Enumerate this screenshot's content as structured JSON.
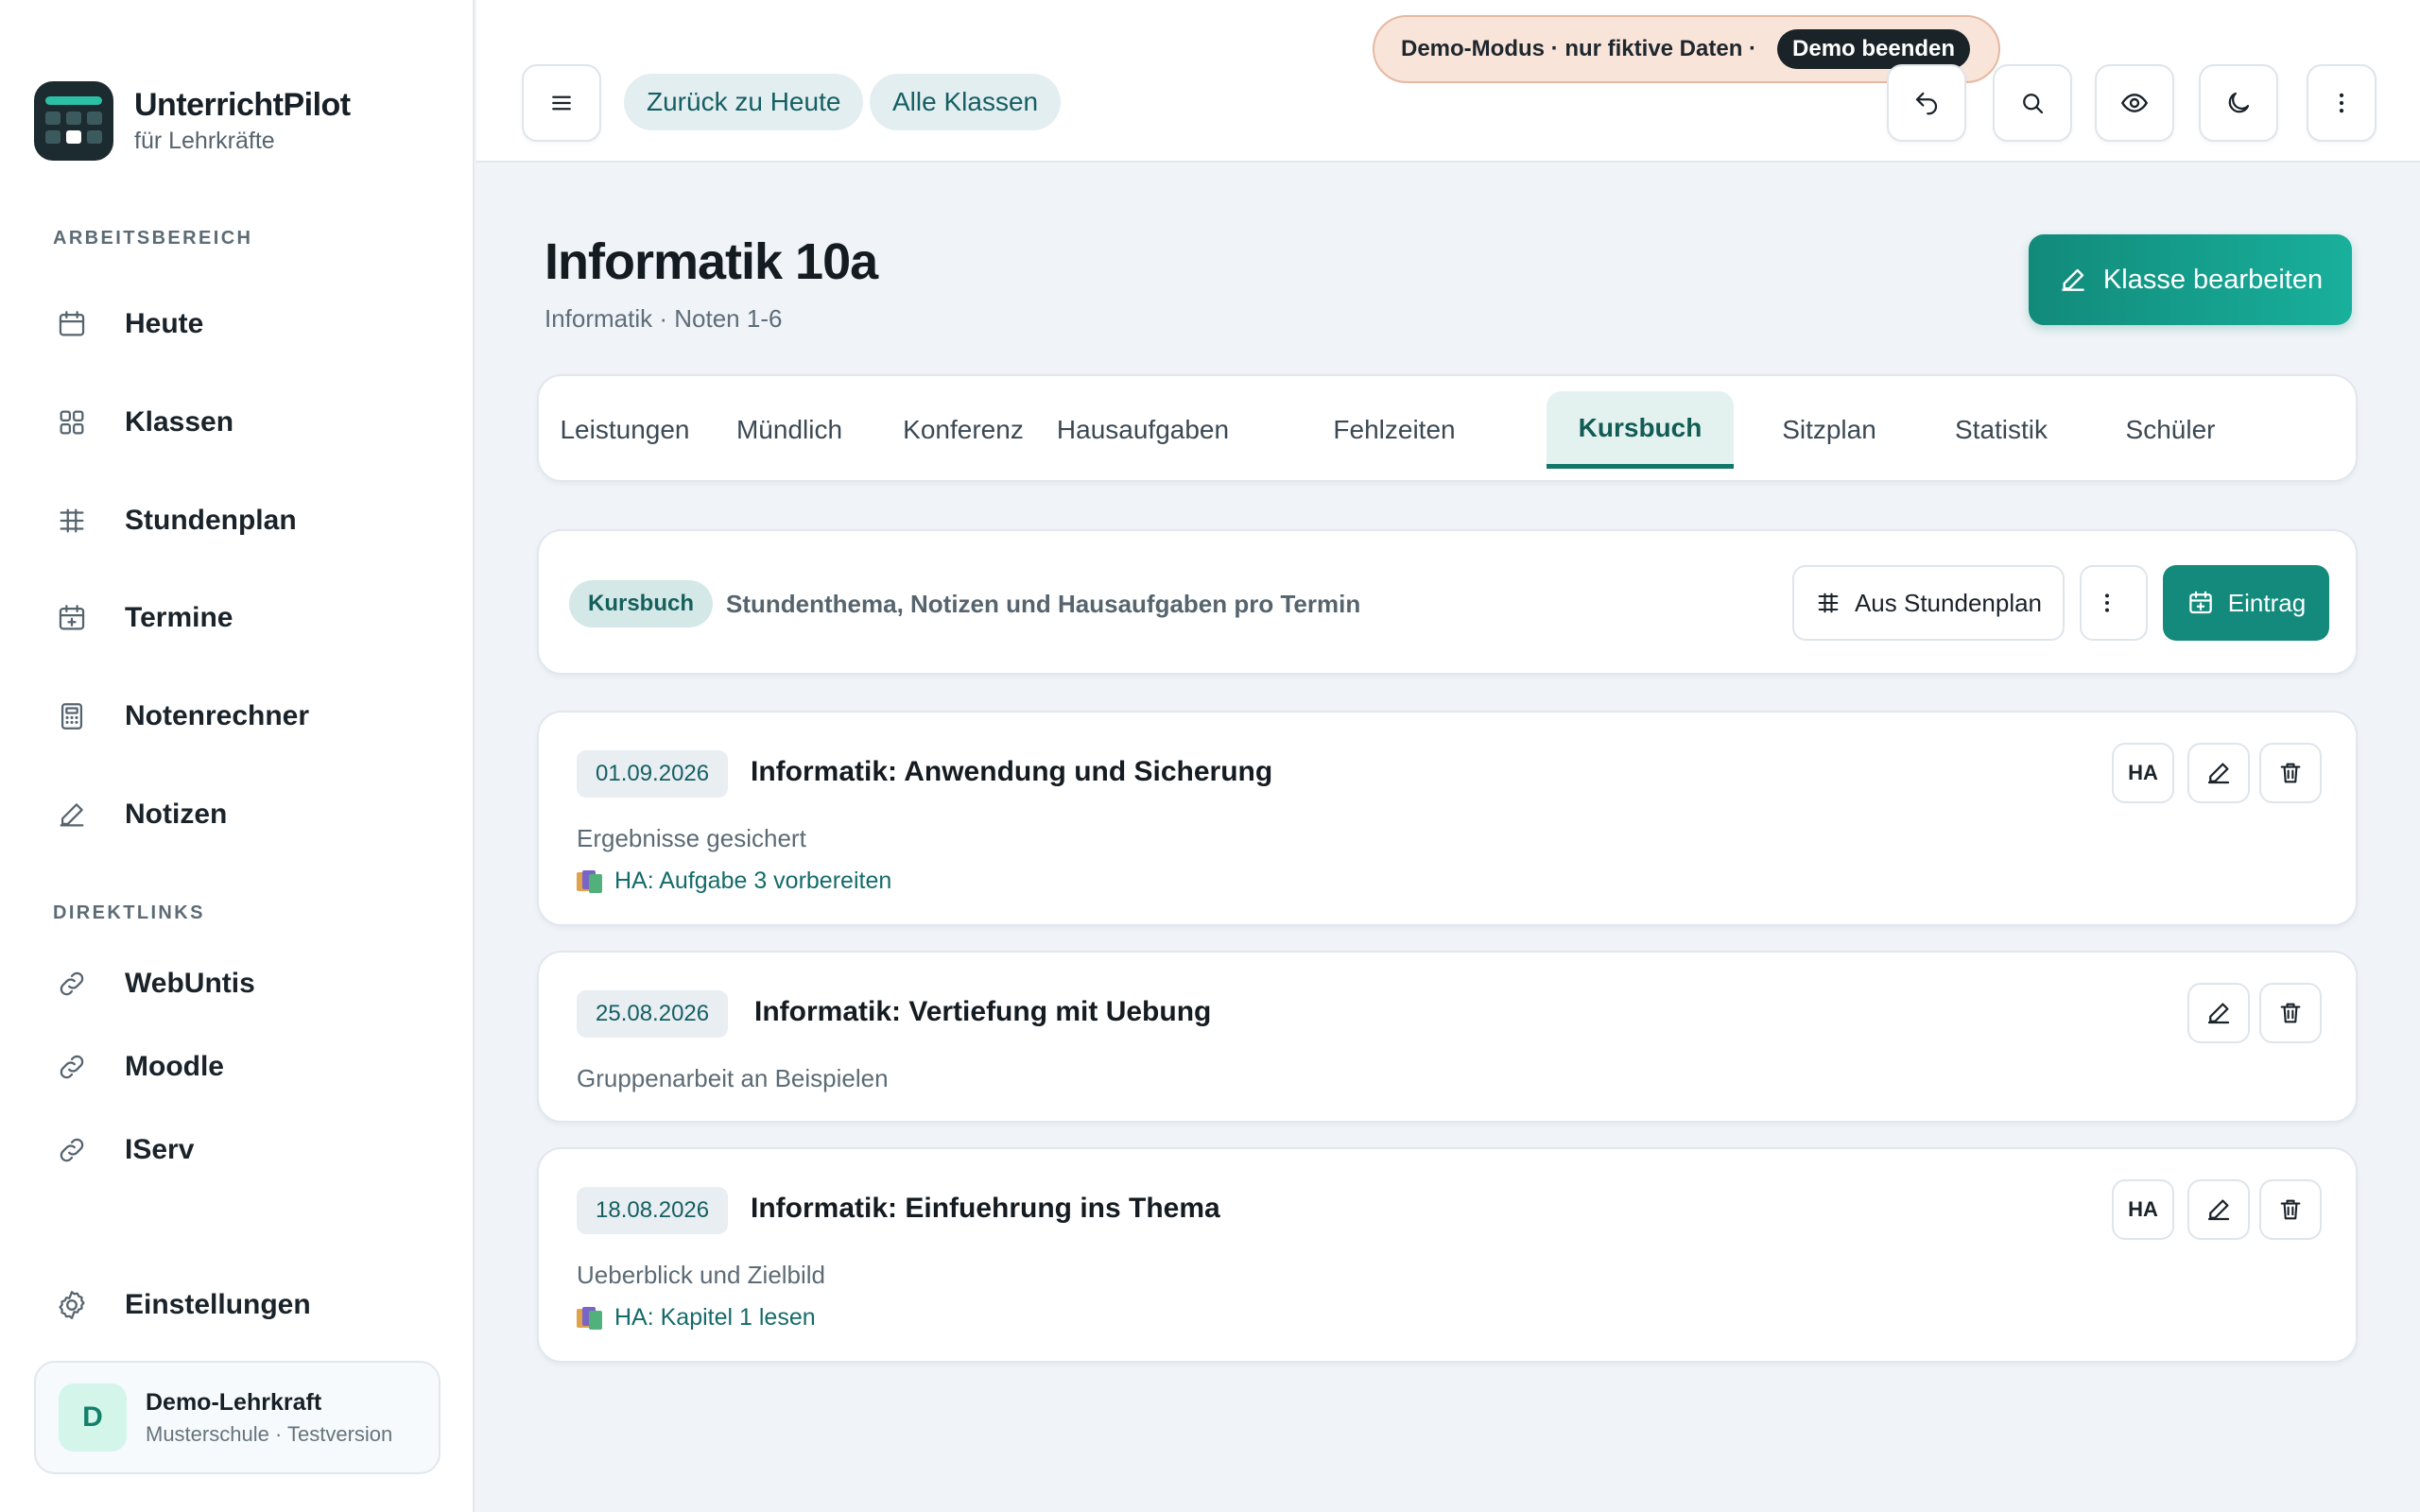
{
  "brand": {
    "name": "UnterrichtPilot",
    "subtitle": "für Lehrkräfte"
  },
  "sidebar": {
    "section_work": "ARBEITSBEREICH",
    "items": [
      {
        "label": "Heute",
        "icon": "calendar-icon"
      },
      {
        "label": "Klassen",
        "icon": "grid-icon"
      },
      {
        "label": "Stundenplan",
        "icon": "table-icon"
      },
      {
        "label": "Termine",
        "icon": "calendar-plus-icon"
      },
      {
        "label": "Notenrechner",
        "icon": "calculator-icon"
      },
      {
        "label": "Notizen",
        "icon": "pen-icon"
      }
    ],
    "section_links": "DIREKTLINKS",
    "links": [
      {
        "label": "WebUntis",
        "icon": "link-icon"
      },
      {
        "label": "Moodle",
        "icon": "link-icon"
      },
      {
        "label": "IServ",
        "icon": "link-icon"
      }
    ],
    "settings_label": "Einstellungen",
    "user": {
      "initial": "D",
      "name": "Demo-Lehrkraft",
      "school": "Musterschule · Testversion"
    }
  },
  "topbar": {
    "back_today": "Zurück zu Heute",
    "all_classes": "Alle Klassen",
    "demo_text": "Demo-Modus · nur fiktive Daten ·",
    "demo_end": "Demo beenden"
  },
  "page": {
    "title": "Informatik 10a",
    "subtitle": "Informatik · Noten 1-6",
    "edit_class": "Klasse bearbeiten"
  },
  "tabs": [
    {
      "label": "Leistungen",
      "active": false
    },
    {
      "label": "Mündlich",
      "active": false
    },
    {
      "label": "Konferenz",
      "active": false
    },
    {
      "label": "Hausaufgaben",
      "active": false
    },
    {
      "label": "Fehlzeiten",
      "active": false
    },
    {
      "label": "Kursbuch",
      "active": true
    },
    {
      "label": "Sitzplan",
      "active": false
    },
    {
      "label": "Statistik",
      "active": false
    },
    {
      "label": "Schüler",
      "active": false
    }
  ],
  "toolbar": {
    "badge": "Kursbuch",
    "description": "Stundenthema, Notizen und Hausaufgaben pro Termin",
    "from_schedule": "Aus Stundenplan",
    "add_entry": "Eintrag"
  },
  "entries": [
    {
      "date": "01.09.2026",
      "title": "Informatik: Anwendung und Sicherung",
      "note": "Ergebnisse gesichert",
      "homework": "HA: Aufgabe 3 vorbereiten",
      "ha_label": "HA"
    },
    {
      "date": "25.08.2026",
      "title": "Informatik: Vertiefung mit Uebung",
      "note": "Gruppenarbeit an Beispielen"
    },
    {
      "date": "18.08.2026",
      "title": "Informatik: Einfuehrung ins Thema",
      "note": "Ueberblick und Zielbild",
      "homework": "HA: Kapitel 1 lesen",
      "ha_label": "HA"
    }
  ],
  "colors": {
    "accent": "#138a7b",
    "accent_light": "#e4f2ef",
    "demo_bg": "#f9e4da",
    "dark": "#1c2b30"
  }
}
